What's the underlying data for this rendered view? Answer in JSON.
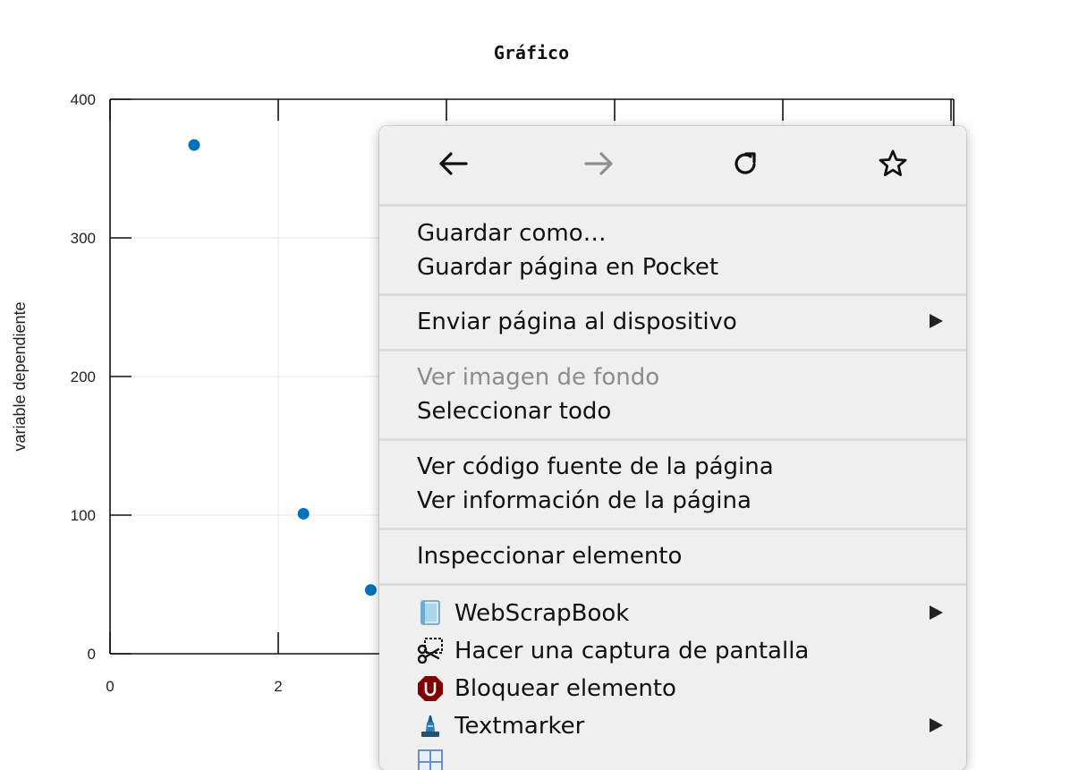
{
  "chart_data": {
    "type": "scatter",
    "title": "Gráfico",
    "ylabel": "variable dependiente",
    "xlabel": "",
    "xlim": [
      0,
      10
    ],
    "ylim": [
      0,
      400
    ],
    "x_ticks": [
      "0",
      "2"
    ],
    "y_ticks": [
      "0",
      "100",
      "200",
      "300",
      "400"
    ],
    "grid": true,
    "series": [
      {
        "color": "#0072bd",
        "x": [
          1.0,
          2.3,
          3.1
        ],
        "y": [
          367,
          101,
          46
        ]
      }
    ]
  },
  "context_menu": {
    "nav": {
      "back": "arrow-left-icon",
      "forward": "arrow-right-icon",
      "reload": "reload-icon",
      "bookmark": "star-icon"
    },
    "items": {
      "save_as": "Guardar como…",
      "save_pocket": "Guardar página en Pocket",
      "send_device": "Enviar página al dispositivo",
      "view_bg": "Ver imagen de fondo",
      "select_all": "Seleccionar todo",
      "view_source": "Ver código fuente de la página",
      "view_info": "Ver información de la página",
      "inspect": "Inspeccionar elemento",
      "webscrapbook": "WebScrapBook",
      "screenshot": "Hacer una captura de pantalla",
      "block": "Bloquear elemento",
      "textmarker": "Textmarker"
    }
  }
}
